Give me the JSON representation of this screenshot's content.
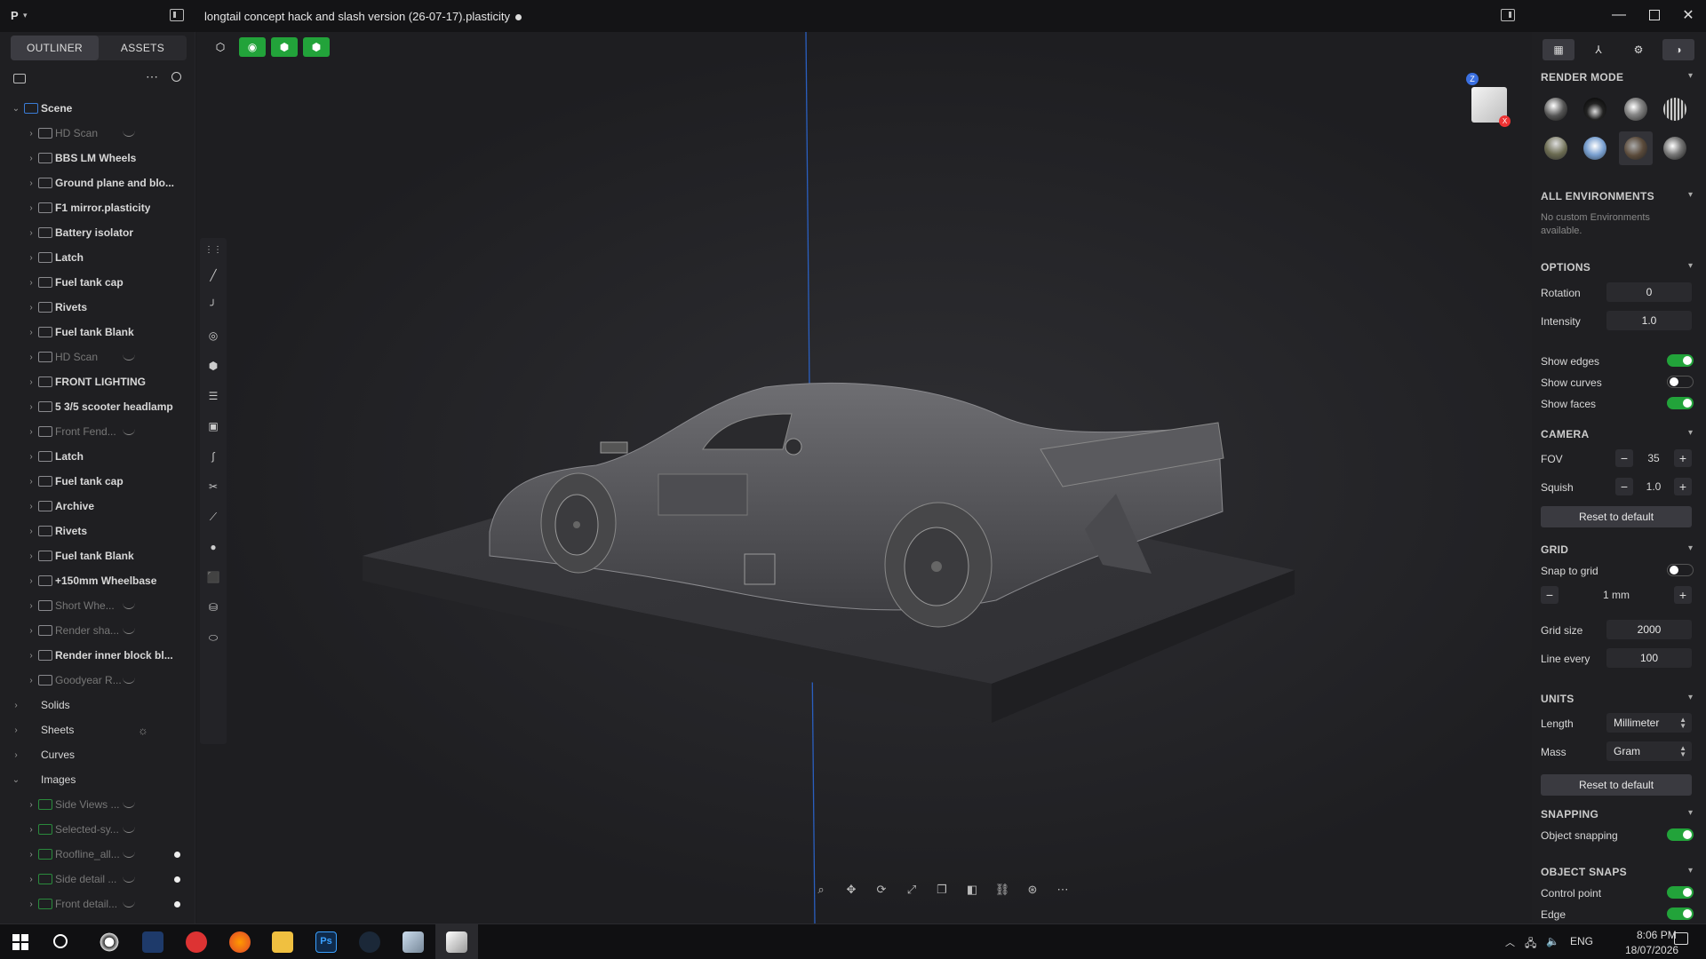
{
  "titlebar": {
    "logo": "P",
    "document_title": "longtail concept hack and slash version (26-07-17).plasticity"
  },
  "sidebar": {
    "tabs": [
      "OUTLINER",
      "ASSETS"
    ],
    "tree": [
      {
        "label": "Scene",
        "level": 0,
        "expanded": true,
        "dim": false,
        "icon": "folder-blue"
      },
      {
        "label": "HD Scan",
        "level": 1,
        "dim": true,
        "hidden_eye": true
      },
      {
        "label": "BBS LM Wheels",
        "level": 1
      },
      {
        "label": "Ground plane and blo...",
        "level": 1
      },
      {
        "label": "F1 mirror.plasticity",
        "level": 1
      },
      {
        "label": "Battery isolator",
        "level": 1
      },
      {
        "label": "Latch",
        "level": 1
      },
      {
        "label": "Fuel tank cap",
        "level": 1
      },
      {
        "label": "Rivets",
        "level": 1
      },
      {
        "label": "Fuel tank Blank",
        "level": 1
      },
      {
        "label": "HD Scan",
        "level": 1,
        "dim": true,
        "hidden_eye": true
      },
      {
        "label": "FRONT LIGHTING",
        "level": 1
      },
      {
        "label": "5 3/5 scooter headlamp",
        "level": 1
      },
      {
        "label": "Front Fend...",
        "level": 1,
        "dim": true,
        "hidden_eye": true
      },
      {
        "label": "Latch",
        "level": 1
      },
      {
        "label": "Fuel tank cap",
        "level": 1
      },
      {
        "label": "Archive",
        "level": 1
      },
      {
        "label": "Rivets",
        "level": 1
      },
      {
        "label": "Fuel tank Blank",
        "level": 1
      },
      {
        "label": "+150mm Wheelbase",
        "level": 1
      },
      {
        "label": "Short Whe...",
        "level": 1,
        "dim": true,
        "hidden_eye": true
      },
      {
        "label": "Render sha...",
        "level": 1,
        "dim": true,
        "hidden_eye": true
      },
      {
        "label": "Render inner block bl...",
        "level": 1
      },
      {
        "label": "Goodyear R...",
        "level": 1,
        "dim": true,
        "hidden_eye": true
      },
      {
        "label": "Solids",
        "level": 0,
        "plain": true
      },
      {
        "label": "Sheets",
        "level": 0,
        "plain": true,
        "sheets_icon": true
      },
      {
        "label": "Curves",
        "level": 0,
        "plain": true
      },
      {
        "label": "Images",
        "level": 0,
        "plain": true,
        "expanded": true
      },
      {
        "label": "Side Views ...",
        "level": 1,
        "dim": true,
        "hidden_eye": true,
        "icon": "image-green"
      },
      {
        "label": "Selected-sy...",
        "level": 1,
        "dim": true,
        "hidden_eye": true,
        "icon": "image-green"
      },
      {
        "label": "Roofline_all...",
        "level": 1,
        "dim": true,
        "hidden_eye": true,
        "icon": "image-green",
        "dot": true
      },
      {
        "label": "Side detail ...",
        "level": 1,
        "dim": true,
        "hidden_eye": true,
        "icon": "image-green",
        "dot": true
      },
      {
        "label": "Front detail...",
        "level": 1,
        "dim": true,
        "hidden_eye": true,
        "icon": "image-green",
        "dot": true
      }
    ]
  },
  "right_panel": {
    "render_mode": {
      "title": "RENDER MODE"
    },
    "environments": {
      "title": "ALL ENVIRONMENTS",
      "empty_text": "No custom Environments available."
    },
    "options": {
      "title": "OPTIONS",
      "rotation_label": "Rotation",
      "rotation_value": "0",
      "intensity_label": "Intensity",
      "intensity_value": "1.0",
      "show_edges_label": "Show edges",
      "show_edges": true,
      "show_curves_label": "Show curves",
      "show_curves": false,
      "show_faces_label": "Show faces",
      "show_faces": true
    },
    "camera": {
      "title": "CAMERA",
      "fov_label": "FOV",
      "fov_value": "35",
      "squish_label": "Squish",
      "squish_value": "1.0",
      "reset_label": "Reset to default"
    },
    "grid": {
      "title": "GRID",
      "snap_label": "Snap to grid",
      "snap": false,
      "step_value": "1 mm",
      "grid_size_label": "Grid size",
      "grid_size_value": "2000",
      "line_every_label": "Line every",
      "line_every_value": "100"
    },
    "units": {
      "title": "UNITS",
      "length_label": "Length",
      "length_value": "Millimeter",
      "mass_label": "Mass",
      "mass_value": "Gram",
      "reset_label": "Reset to default"
    },
    "snapping": {
      "title": "SNAPPING",
      "object_snapping_label": "Object snapping",
      "object_snapping": true
    },
    "object_snaps": {
      "title": "OBJECT SNAPS",
      "control_point_label": "Control point",
      "control_point": true,
      "edge_label": "Edge",
      "edge": true
    }
  },
  "viewport": {
    "nav_z": "Z",
    "nav_x": "X"
  },
  "taskbar": {
    "lang": "ENG",
    "time": "8:06 PM",
    "date": "18/07/2026"
  },
  "colors": {
    "accent_green": "#22a33a",
    "folder_blue": "#3a7bd5",
    "background": "#1b1b1d"
  }
}
